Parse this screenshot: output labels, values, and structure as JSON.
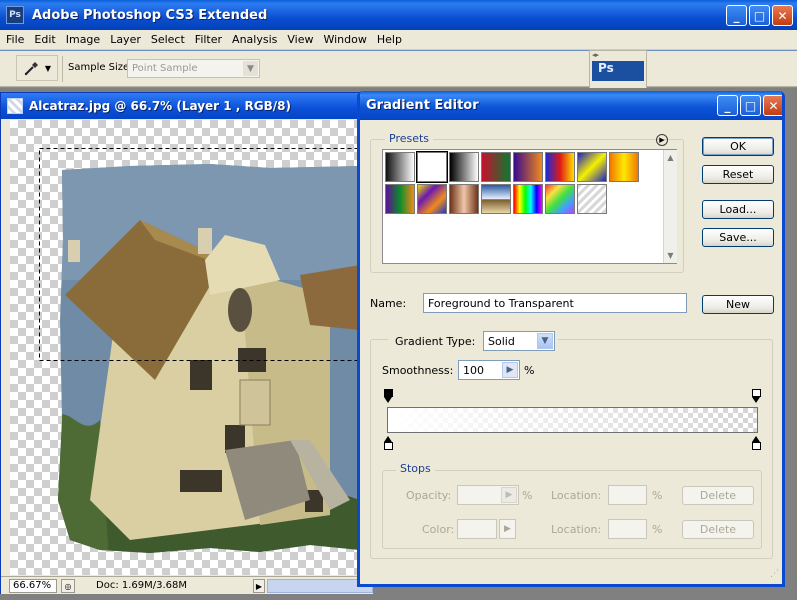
{
  "app": {
    "title": "Adobe Photoshop CS3 Extended",
    "logo_text": "Ps",
    "window_buttons": [
      "minimize-icon",
      "maximize-icon",
      "close-icon"
    ]
  },
  "menubar": {
    "items": [
      "File",
      "Edit",
      "Image",
      "Layer",
      "Select",
      "Filter",
      "Analysis",
      "View",
      "Window",
      "Help"
    ]
  },
  "options_bar": {
    "tool_icon": "eyedropper-icon",
    "sample_size_label": "Sample Size:",
    "sample_size_value": "Point Sample"
  },
  "palette_well": {
    "label": "Ps"
  },
  "document": {
    "title": "Alcatraz.jpg @ 66.7% (Layer 1 , RGB/8)",
    "zoom": "66.67%",
    "doc_info": "Doc: 1.69M/3.68M"
  },
  "dialog": {
    "title": "Gradient Editor",
    "presets_label": "Presets",
    "preset_swatches": [
      {
        "name": "foreground-to-background",
        "css": "linear-gradient(to right, #111, #fff)"
      },
      {
        "name": "foreground-to-transparent",
        "css": "linear-gradient(to right, #fff, rgba(255,255,255,0))"
      },
      {
        "name": "black-white",
        "css": "linear-gradient(to right, #000, #fff)"
      },
      {
        "name": "red-green",
        "css": "linear-gradient(to right, #c8102e, #0a7a2f)"
      },
      {
        "name": "violet-orange",
        "css": "linear-gradient(to right, #3b0a8c, #f08a1c)"
      },
      {
        "name": "blue-red-yellow",
        "css": "linear-gradient(to right, #1a2bd8, #e01818, #ffe000)"
      },
      {
        "name": "blue-yellow-blue",
        "css": "linear-gradient(135deg, #1d21c8, #f6f000, #1d21c8)"
      },
      {
        "name": "orange-yellow-orange",
        "css": "linear-gradient(to right, #f07800, #ffe800, #f07800)"
      },
      {
        "name": "violet-green-orange",
        "css": "linear-gradient(to right, #5e0f96, #0c8c2a, #f08a1c)"
      },
      {
        "name": "yellow-violet-orange-blue",
        "css": "linear-gradient(135deg, #f0e000, #6a1ab0, #f08a1c, #1d3ac8)"
      },
      {
        "name": "copper",
        "css": "linear-gradient(to right, #6b3418, #f1c6a8, #6b3418)"
      },
      {
        "name": "chrome",
        "css": "linear-gradient(to bottom, #2b5aa0, #e6f0ff 50%, #7a5a2a 52%, #e8d6a8)"
      },
      {
        "name": "spectrum",
        "css": "linear-gradient(to right, #ff0000, #ffff00, #00ff00, #00ffff, #0000ff, #ff00ff)"
      },
      {
        "name": "transparent-rainbow",
        "css": "linear-gradient(135deg, #ff3030, #ffe040, #40e040, #40a0ff, #c040ff)"
      },
      {
        "name": "transparent-stripes",
        "css": "repeating-linear-gradient(135deg, #d8d8d8 0 3px, #fff 3px 6px)"
      }
    ],
    "buttons": {
      "ok": "OK",
      "reset": "Reset",
      "load": "Load...",
      "save": "Save...",
      "new": "New"
    },
    "name_label": "Name:",
    "name_value": "Foreground to Transparent",
    "gradient_type_label": "Gradient Type:",
    "gradient_type_value": "Solid",
    "smoothness_label": "Smoothness:",
    "smoothness_value": "100",
    "smoothness_unit": "%",
    "stops": {
      "label": "Stops",
      "opacity_label": "Opacity:",
      "opacity_unit": "%",
      "color_label": "Color:",
      "location_label": "Location:",
      "location_unit": "%",
      "delete_label": "Delete"
    }
  }
}
